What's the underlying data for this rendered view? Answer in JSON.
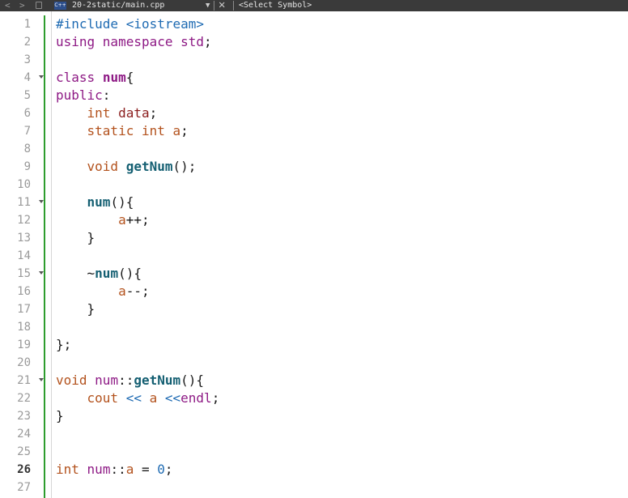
{
  "editor": {
    "file_label": "20-2static/main.cpp",
    "file_icon_label": "C++",
    "symbol_selector": "<Select Symbol>"
  },
  "lines": [
    {
      "n": "1",
      "text": "#include <iostream>"
    },
    {
      "n": "2",
      "text": "using namespace std;"
    },
    {
      "n": "3",
      "text": ""
    },
    {
      "n": "4",
      "text": "class num{"
    },
    {
      "n": "5",
      "text": "public:"
    },
    {
      "n": "6",
      "text": "    int data;"
    },
    {
      "n": "7",
      "text": "    static int a;"
    },
    {
      "n": "8",
      "text": ""
    },
    {
      "n": "9",
      "text": "    void getNum();"
    },
    {
      "n": "10",
      "text": ""
    },
    {
      "n": "11",
      "text": "    num(){"
    },
    {
      "n": "12",
      "text": "        a++;"
    },
    {
      "n": "13",
      "text": "    }"
    },
    {
      "n": "14",
      "text": ""
    },
    {
      "n": "15",
      "text": "    ~num(){"
    },
    {
      "n": "16",
      "text": "        a--;"
    },
    {
      "n": "17",
      "text": "    }"
    },
    {
      "n": "18",
      "text": ""
    },
    {
      "n": "19",
      "text": "};"
    },
    {
      "n": "20",
      "text": ""
    },
    {
      "n": "21",
      "text": "void num::getNum(){"
    },
    {
      "n": "22",
      "text": "    cout << a <<endl;"
    },
    {
      "n": "23",
      "text": "}"
    },
    {
      "n": "24",
      "text": ""
    },
    {
      "n": "25",
      "text": ""
    },
    {
      "n": "26",
      "text": "int num::a = 0;"
    },
    {
      "n": "27",
      "text": ""
    }
  ],
  "current_line": "26",
  "folds": [
    "4",
    "11",
    "15",
    "21"
  ],
  "colors": {
    "preprocessor": "#1f6bb3",
    "keyword": "#8e1a85",
    "type": "#b3521d",
    "function": "#145f72",
    "gutter_bar": "#2e9d2e"
  }
}
